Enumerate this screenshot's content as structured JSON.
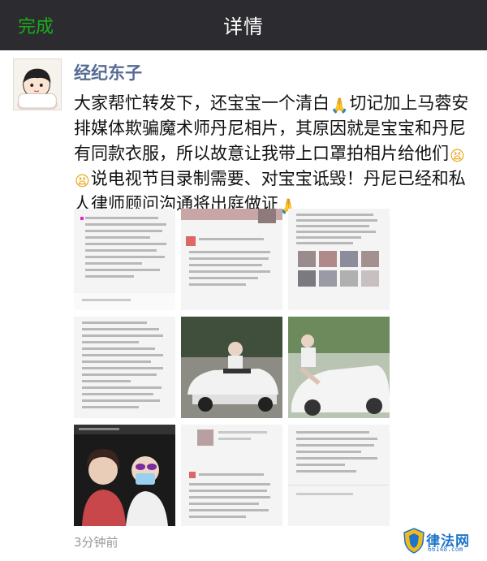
{
  "navbar": {
    "back_label": "完成",
    "title": "详情"
  },
  "post": {
    "author": "经纪东子",
    "text_segments": [
      "大家帮忙转发下，还宝宝一个清白",
      "切记加上马蓉安排媒体欺骗魔术师丹尼相片，其原因就是宝宝和丹尼有同款衣服，所以故意让我带上口罩拍相片给他们",
      "说电视节目录制需要、对宝宝诋毁！丹尼已经和私人律师顾问沟通将出庭做证"
    ],
    "emoji": {
      "pray": "🙏",
      "tired": "😫"
    },
    "time": "3分钟前",
    "images": [
      {
        "kind": "chat-screenshot",
        "icon": "chat-screenshot-image"
      },
      {
        "kind": "chat-screenshot",
        "icon": "chat-screenshot-image"
      },
      {
        "kind": "chat-screenshot",
        "icon": "chat-screenshot-image"
      },
      {
        "kind": "chat-screenshot",
        "icon": "chat-screenshot-image"
      },
      {
        "kind": "photo",
        "icon": "car-photo"
      },
      {
        "kind": "photo",
        "icon": "car-photo"
      },
      {
        "kind": "photo",
        "icon": "selfie-photo"
      },
      {
        "kind": "chat-screenshot",
        "icon": "chat-screenshot-image"
      },
      {
        "kind": "chat-screenshot",
        "icon": "chat-screenshot-image"
      }
    ]
  },
  "watermark": {
    "brand": "律法网",
    "url": "66148.com"
  },
  "colors": {
    "navbar_bg": "#2b2b30",
    "back_green": "#1aad19",
    "author_blue": "#576b95",
    "watermark_blue": "#1d74c9"
  }
}
